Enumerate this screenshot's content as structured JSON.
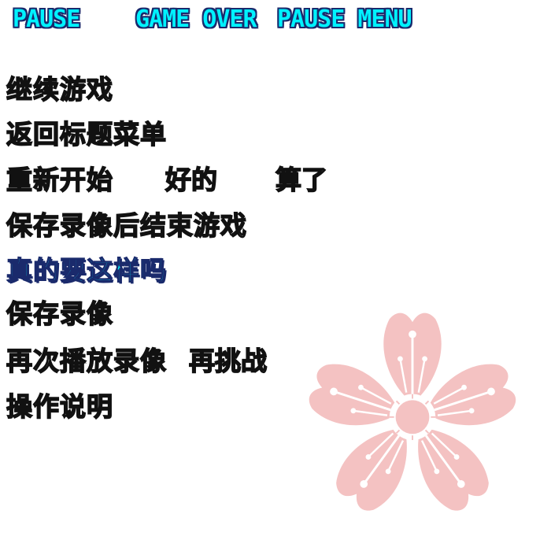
{
  "titles": {
    "pause": "PAUSE",
    "game_over": "GAME OVER",
    "pause_menu": "PAUSE MENU"
  },
  "menu": {
    "continue_game": "继续游戏",
    "return_title": "返回标题菜单",
    "restart": "重新开始",
    "confirm_ok": "好的",
    "confirm_cancel": "算了",
    "save_replay_quit": "保存录像后结束游戏",
    "really": "真的要这样吗",
    "save_replay": "保存录像",
    "replay_again": "再次播放录像",
    "retry": "再挑战",
    "controls": "操作说明"
  },
  "colors": {
    "title_fill": "#00f2ff",
    "title_outline": "#1a2a6c",
    "menu_outline": "#111111",
    "sakura_pink": "#f4c2c2"
  },
  "icons": {
    "decoration": "sakura-flower-icon"
  }
}
